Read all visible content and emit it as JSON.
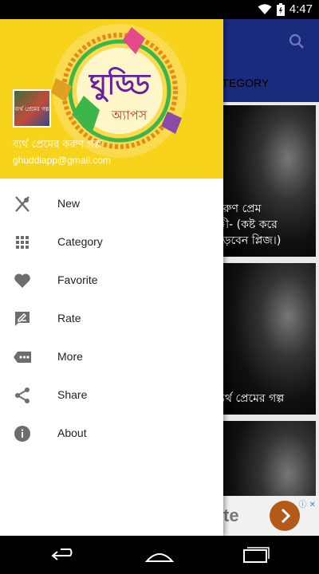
{
  "status_bar": {
    "time": "4:47",
    "icons": [
      "wifi-icon",
      "battery-icon"
    ]
  },
  "app": {
    "tab_label": "ATEGORY",
    "cards": [
      {
        "caption": "করুণ প্রেম\nী- (কষ্ট করে\nপড়বেন প্লিজ।)"
      },
      {
        "caption": "ব্যর্থ প্রেমের গল্প"
      },
      {
        "caption": ""
      }
    ],
    "ad_text": "te"
  },
  "drawer": {
    "logo_title": "ঘুড্ডি",
    "logo_subtitle": "অ্যাপস",
    "avatar_text": "ব্যর্থ প্রেমের গল্প",
    "user_name": "ব্যর্থ প্রেমের করুণ গল্প",
    "email": "ghuddiapp@gmail.com",
    "menu": [
      {
        "label": "New",
        "icon": "fork-knife-icon"
      },
      {
        "label": "Category",
        "icon": "grid-icon"
      },
      {
        "label": "Favorite",
        "icon": "heart-icon"
      },
      {
        "label": "Rate",
        "icon": "rate-icon"
      },
      {
        "label": "More",
        "icon": "more-chat-icon"
      },
      {
        "label": "Share",
        "icon": "share-icon"
      },
      {
        "label": "About",
        "icon": "info-icon"
      }
    ]
  },
  "colors": {
    "header_yellow": "#f8d31c",
    "toolbar_blue": "#1a2a7c",
    "icon_gray": "#6d6d6d"
  }
}
